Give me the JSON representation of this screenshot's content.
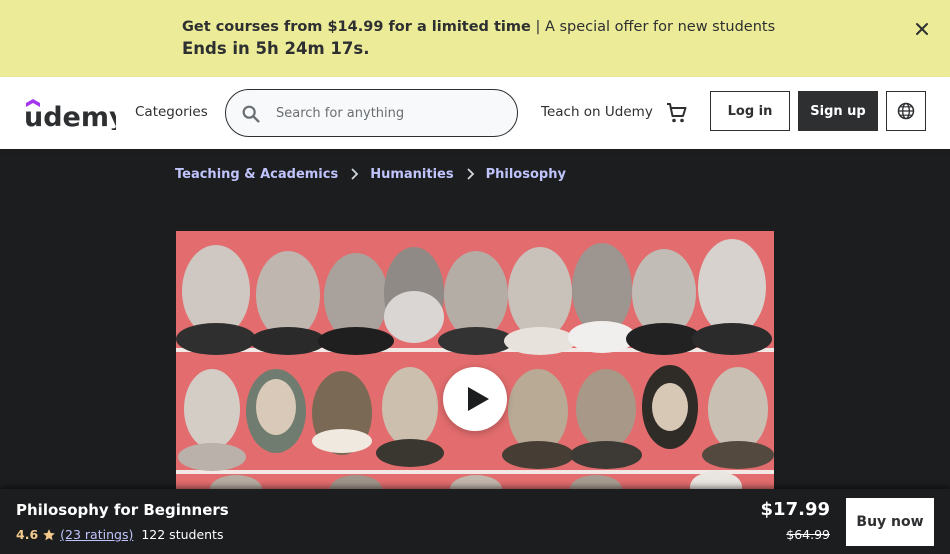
{
  "banner": {
    "offer_text": "Get courses from $14.99 for a limited time",
    "separator": "|",
    "subtext": "A special offer for new students",
    "countdown": "Ends in 5h 24m 17s.",
    "close_icon": "close-icon"
  },
  "header": {
    "logo_text": "udemy",
    "categories_label": "Categories",
    "search_placeholder": "Search for anything",
    "search_value": "",
    "teach_label": "Teach on Udemy",
    "cart_icon": "cart-icon",
    "login_label": "Log in",
    "signup_label": "Sign up",
    "language_icon": "globe-icon"
  },
  "breadcrumb": [
    "Teaching & Academics",
    "Humanities",
    "Philosophy"
  ],
  "preview": {
    "play_icon": "play-icon"
  },
  "course": {
    "title": "Philosophy for Beginners",
    "rating": "4.6",
    "ratings_count": "(23 ratings)",
    "students": "122 students",
    "price": "$17.99",
    "original_price": "$64.99",
    "buy_label": "Buy now"
  },
  "colors": {
    "banner_bg": "#eceb98",
    "dark_bg": "#1c1d1f",
    "accent_link": "#c0c4fc",
    "rating_gold": "#f3ca8c",
    "brand_purple": "#a435f0",
    "preview_red": "#e0686a"
  }
}
